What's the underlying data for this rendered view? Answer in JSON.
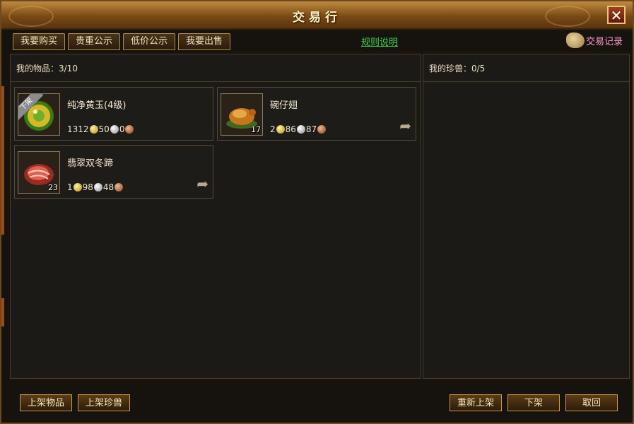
{
  "window": {
    "title": "交易行",
    "close_label": "✕"
  },
  "tabs": [
    {
      "label": "我要购买"
    },
    {
      "label": "贵重公示"
    },
    {
      "label": "低价公示"
    },
    {
      "label": "我要出售"
    }
  ],
  "rules_link": "规则说明",
  "trade_record": "交易记录",
  "my_items": {
    "label": "我的物品：3/10",
    "items": [
      {
        "name": "纯净黄玉(4级)",
        "quantity": "",
        "badge": "下架",
        "gold": "1312",
        "silver": "50",
        "copper": "0",
        "icon": "yellow-jade-icon"
      },
      {
        "name": "碗仔翅",
        "quantity": "17",
        "badge": "",
        "gold": "2",
        "silver": "86",
        "copper": "87",
        "icon": "roast-chicken-icon"
      },
      {
        "name": "翡翠双冬蹄",
        "quantity": "23",
        "badge": "",
        "gold": "1",
        "silver": "98",
        "copper": "48",
        "icon": "meat-icon"
      }
    ]
  },
  "my_pets": {
    "label": "我的珍兽：0/5"
  },
  "buttons": {
    "list_item": "上架物品",
    "list_pet": "上架珍兽",
    "relist": "重新上架",
    "delist": "下架",
    "cancel": "取回"
  },
  "colors": {
    "accent_gold": "#c08a3e",
    "link_green": "#3fcf4f",
    "record_pink": "#ff9ad0"
  }
}
